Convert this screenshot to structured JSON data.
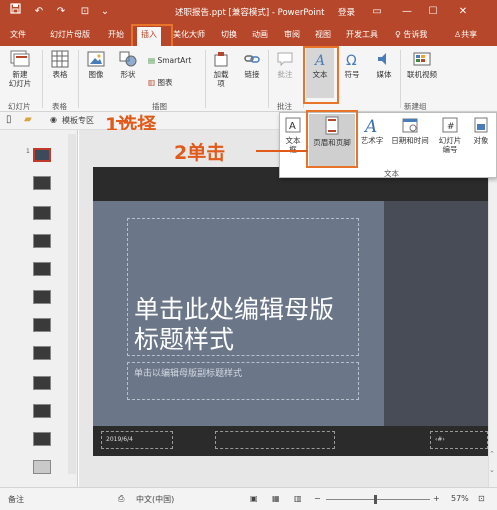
{
  "titlebar": {
    "filename": "述职报告.ppt [兼容模式] - PowerPoint",
    "login": "登录",
    "icons": [
      "save-icon",
      "undo-icon",
      "redo-icon",
      "slideshow-icon",
      "ribbon-options-icon",
      "minimize-icon",
      "maximize-icon",
      "close-icon"
    ]
  },
  "tabs": [
    {
      "label": "文件",
      "active": false
    },
    {
      "label": "幻灯片母版",
      "active": false
    },
    {
      "label": "开始",
      "active": false
    },
    {
      "label": "插入",
      "active": true
    },
    {
      "label": "美化大师",
      "active": false
    },
    {
      "label": "切换",
      "active": false
    },
    {
      "label": "动画",
      "active": false
    },
    {
      "label": "审阅",
      "active": false
    },
    {
      "label": "视图",
      "active": false
    },
    {
      "label": "开发工具",
      "active": false
    }
  ],
  "tellme": "告诉我",
  "share": "共享",
  "ribbon": {
    "new_slide": "新建\n幻灯片",
    "table": "表格",
    "image": "图像",
    "shapes": "形状",
    "smartart": "SmartArt",
    "chart": "图表",
    "addins": "加载\n项",
    "link": "链接",
    "comment": "批注",
    "text": "文本",
    "symbol": "符号",
    "media": "媒体",
    "online_video": "联机视频",
    "groups": {
      "slides": "幻灯片",
      "tables": "表格",
      "illustrations": "插图",
      "comments": "批注",
      "newgroup": "新建组"
    }
  },
  "quickbar": {
    "template_label": "模板专区"
  },
  "text_panel": {
    "textbox": "文本框",
    "header_footer": "页眉和页脚",
    "wordart": "艺术字",
    "datetime": "日期和时间",
    "slide_number": "幻灯片\n编号",
    "object": "对象",
    "group_label": "文本"
  },
  "callouts": {
    "step1": "1选择",
    "step2": "2单击"
  },
  "slide": {
    "title": "单击此处编辑母版标题样式",
    "subtitle": "单击以编辑母版副标题样式",
    "footer_date": "2019/6/4",
    "footer_num": "‹#›"
  },
  "thumbnails": {
    "count": 12
  },
  "statusbar": {
    "notes": "备注",
    "language": "中文(中国)",
    "zoom": "57%"
  },
  "colors": {
    "accent": "#b7472a",
    "highlight": "#e8742a",
    "callout_text": "#e05a1a",
    "slide_bg": "#6b7689",
    "slide_band": "#2b2b2b"
  }
}
